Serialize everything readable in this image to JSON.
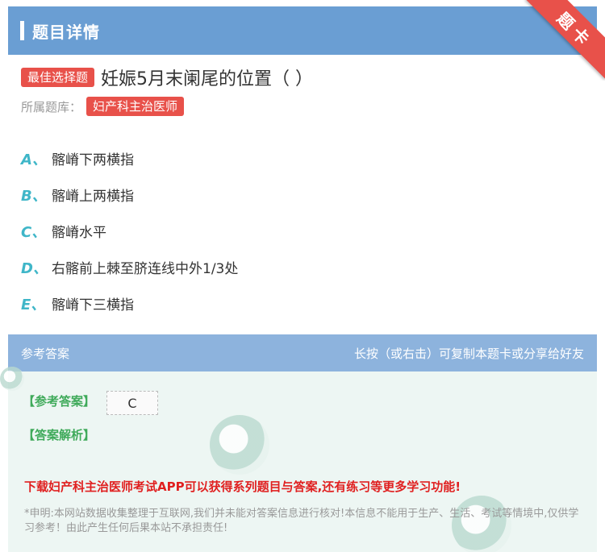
{
  "header": {
    "title": "题目详情"
  },
  "ribbon": {
    "label": "题卡"
  },
  "question": {
    "type_badge": "最佳选择题",
    "text": "妊娠5月末阑尾的位置（ ）"
  },
  "bank": {
    "label": "所属题库：",
    "name": "妇产科主治医师"
  },
  "options": [
    {
      "letter": "A、",
      "text": "髂嵴下两横指"
    },
    {
      "letter": "B、",
      "text": "髂嵴上两横指"
    },
    {
      "letter": "C、",
      "text": "髂嵴水平"
    },
    {
      "letter": "D、",
      "text": "右髂前上棘至脐连线中外1/3处"
    },
    {
      "letter": "E、",
      "text": "髂嵴下三横指"
    }
  ],
  "answer": {
    "head_left": "参考答案",
    "head_right": "长按（或右击）可复制本题卡或分享给好友",
    "ref_label": "【参考答案】",
    "ref_value": "C",
    "analysis_label": "【答案解析】",
    "promo": "下载妇产科主治医师考试APP可以获得系列题目与答案,还有练习等更多学习功能!",
    "disclaimer": "*申明:本网站数据收集整理于互联网,我们并未能对答案信息进行核对!本信息不能用于生产、生活、考试等情境中,仅供学习参考！由此产生任何后果本站不承担责任!"
  },
  "colors": {
    "header": "#6a9ed3",
    "accent_red": "#e8514a",
    "option_letter": "#3fb6c8",
    "answer_green": "#3faa5a"
  }
}
